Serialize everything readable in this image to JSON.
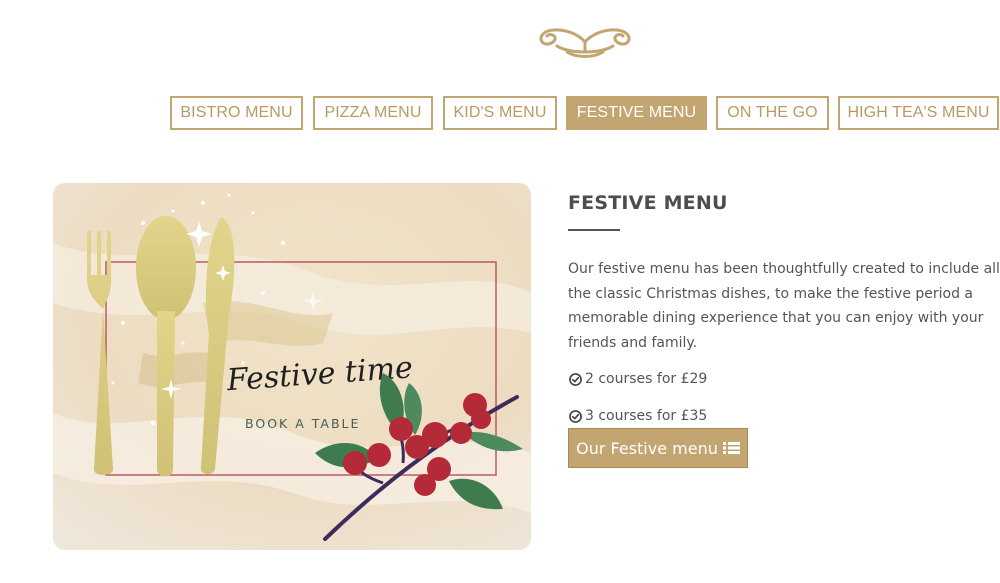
{
  "colors": {
    "gold": "#c2a570",
    "text": "#555555",
    "berry": "#b52a38",
    "leaf": "#3e7b4f"
  },
  "header": {
    "logo_icon": "ornamental-flourish-icon"
  },
  "tabs": [
    {
      "label": "BISTRO MENU",
      "active": false
    },
    {
      "label": "PIZZA MENU",
      "active": false
    },
    {
      "label": "KID'S MENU",
      "active": false
    },
    {
      "label": "FESTIVE MENU",
      "active": true
    },
    {
      "label": "ON THE GO",
      "active": false
    },
    {
      "label": "HIGH TEA'S MENU",
      "active": false
    }
  ],
  "feature": {
    "script_title": "Festive time",
    "cta": "BOOK A TABLE"
  },
  "section": {
    "title": "FESTIVE MENU",
    "description": "Our festive menu has been thoughtfully created to include all the classic Christmas dishes, to make the festive period a memorable dining experience that you can enjoy with your friends and family.",
    "courses": [
      {
        "icon": "check-circle-icon",
        "text": "2 courses for £29"
      },
      {
        "icon": "check-circle-icon",
        "text": "3 courses for £35"
      }
    ],
    "button_label": "Our Festive menu",
    "button_icon": "list-icon"
  }
}
